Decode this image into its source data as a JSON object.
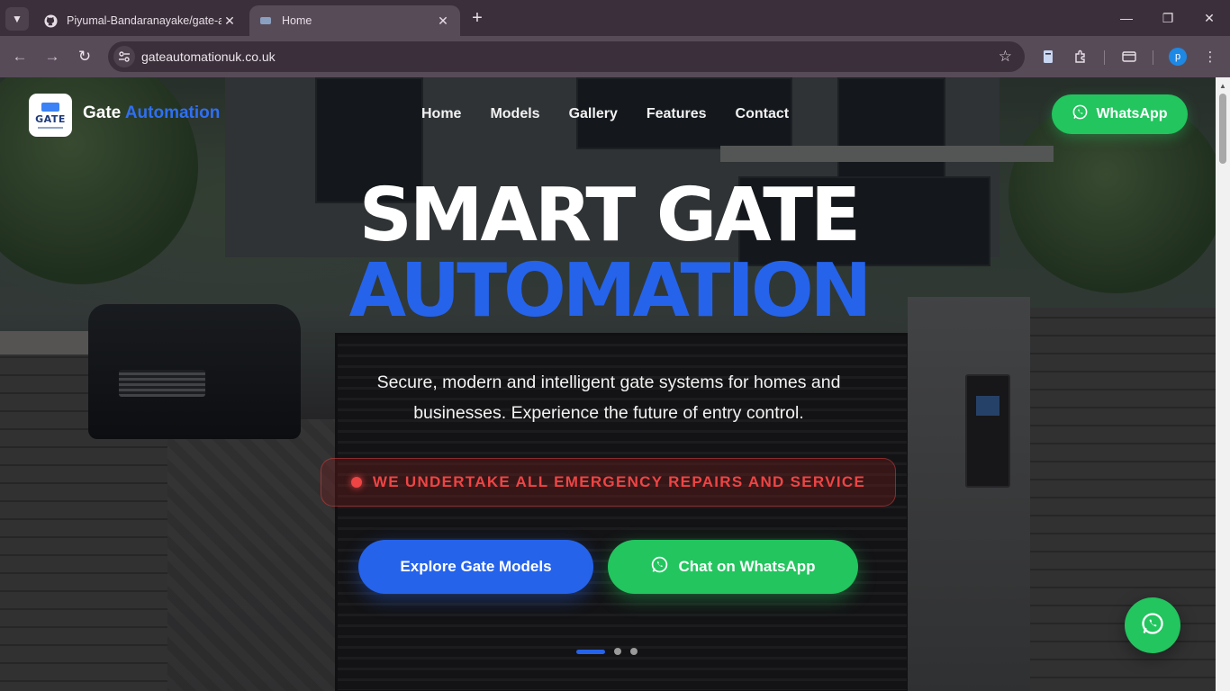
{
  "browser": {
    "tabs": [
      {
        "title": "Piyumal-Bandaranayake/gate-a",
        "icon": "github-icon",
        "active": false
      },
      {
        "title": "Home",
        "icon": "site-favicon",
        "active": true
      }
    ],
    "url": "gateautomationuk.co.uk",
    "profile_initial": "p"
  },
  "site": {
    "brand_first": "Gate",
    "brand_second": "Automation",
    "logo_text": "GATE",
    "nav": [
      "Home",
      "Models",
      "Gallery",
      "Features",
      "Contact"
    ],
    "header_cta": "WhatsApp"
  },
  "hero": {
    "line1": "SMART GATE",
    "line2": "AUTOMATION",
    "subtitle": "Secure, modern and intelligent gate systems for homes and businesses. Experience the future of entry control.",
    "emergency": "WE UNDERTAKE ALL EMERGENCY REPAIRS AND SERVICE",
    "primary_cta": "Explore Gate Models",
    "whatsapp_cta": "Chat on WhatsApp",
    "slides_total": 3,
    "slide_active": 1
  },
  "colors": {
    "accent_blue": "#2563eb",
    "whatsapp_green": "#22c55e",
    "emergency_red": "#ef4444"
  }
}
